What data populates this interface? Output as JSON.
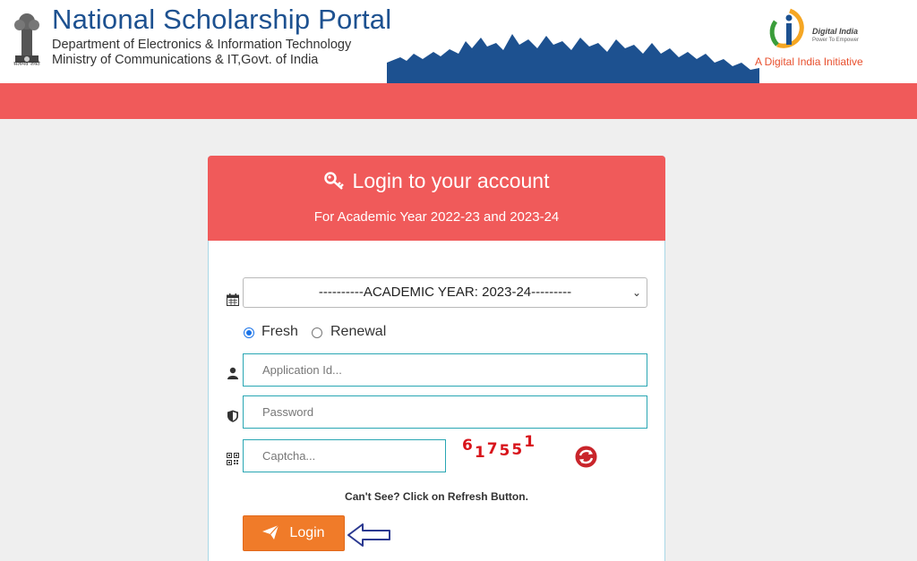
{
  "header": {
    "title": "National Scholarship Portal",
    "department": "Department of Electronics & Information Technology",
    "ministry": "Ministry of Communications & IT,Govt. of India",
    "emblem_caption": "सत्यमेव जयते",
    "digital_india_name": "Digital India",
    "digital_india_tagline": "Power To Empower",
    "digital_india_initiative": "A Digital India Initiative"
  },
  "login": {
    "title": "Login to your account",
    "subtitle": "For Academic Year 2022-23 and 2023-24",
    "academic_year_selected": "----------ACADEMIC YEAR: 2023-24---------",
    "radio_options": [
      {
        "label": "Fresh",
        "checked": true
      },
      {
        "label": "Renewal",
        "checked": false
      }
    ],
    "application_id_placeholder": "Application Id...",
    "password_placeholder": "Password",
    "captcha_placeholder": "Captcha...",
    "captcha_text": [
      "6",
      "1",
      "7",
      "5",
      "5",
      "1"
    ],
    "refresh_hint": "Can't See? Click on Refresh Button.",
    "login_label": "Login"
  },
  "colors": {
    "brand_red": "#f05a5a",
    "title_blue": "#1d5190",
    "login_orange": "#f07b29",
    "captcha_red": "#d8141b"
  },
  "icons": [
    "emblem-icon",
    "key-icon",
    "calendar-icon",
    "user-icon",
    "shield-icon",
    "qr-icon",
    "refresh-icon",
    "send-icon",
    "arrow-left-icon"
  ]
}
